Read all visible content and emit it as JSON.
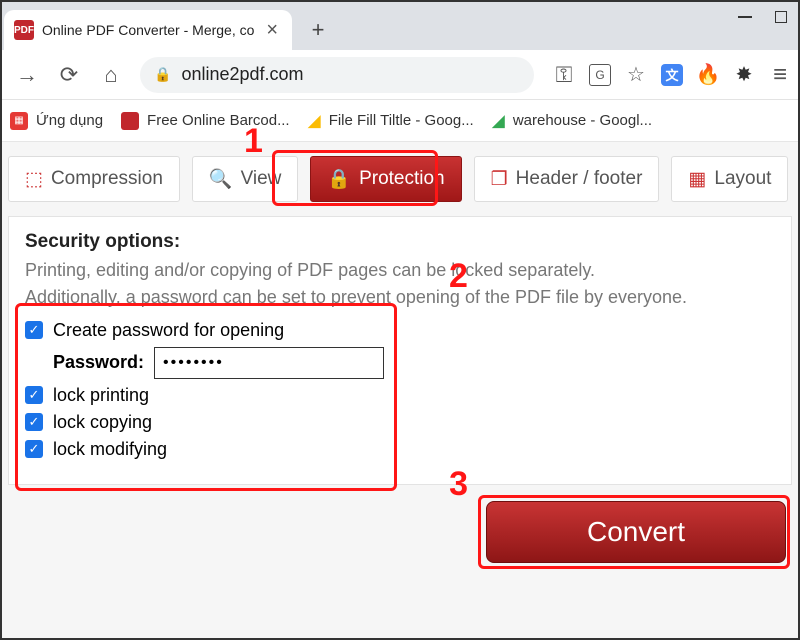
{
  "browser": {
    "tab_title": "Online PDF Converter - Merge, co",
    "new_tab": "+",
    "url": "online2pdf.com",
    "nav": {
      "forward": "→",
      "reload": "⟳",
      "home": "⌂",
      "lock": "🔒",
      "key": "⊶",
      "translate": "G",
      "star": "☆",
      "gt": "文",
      "fire": "🔥",
      "ext": "✦",
      "menu": "≡"
    }
  },
  "bookmarks": {
    "apps": "Ứng dụng",
    "barcode": "Free Online Barcod...",
    "filefill": "File Fill Tiltle - Goog...",
    "warehouse": "warehouse - Googl..."
  },
  "tabs": {
    "compression": "Compression",
    "view": "View",
    "protection": "Protection",
    "header_footer": "Header / footer",
    "layout": "Layout"
  },
  "panel": {
    "title": "Security options:",
    "line1": "Printing, editing and/or copying of PDF pages can be locked separately.",
    "line2": "Additionally, a password can be set to prevent opening of the PDF file by everyone.",
    "create_pw": "Create password for opening",
    "pw_label": "Password:",
    "pw_value": "••••••••",
    "lock_printing": "lock printing",
    "lock_copying": "lock copying",
    "lock_modifying": "lock modifying"
  },
  "convert": {
    "label": "Convert"
  },
  "annot": {
    "n1": "1",
    "n2": "2",
    "n3": "3"
  }
}
